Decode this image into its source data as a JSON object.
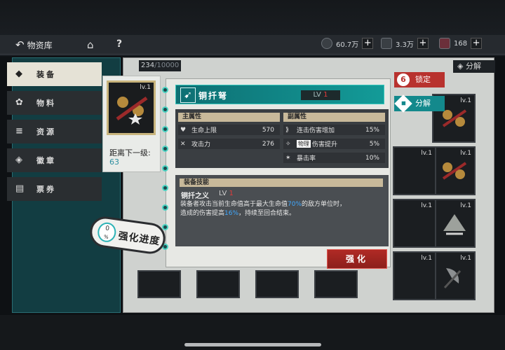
{
  "nav": {
    "back_label": "物资库",
    "resources": [
      {
        "icon": "coin-icon",
        "value": "60.7万"
      },
      {
        "icon": "material-icon",
        "value": "3.3万"
      },
      {
        "icon": "card-icon",
        "value": "168"
      }
    ]
  },
  "sidebar": {
    "tabs": [
      {
        "label": "装备",
        "icon": "equipment-icon",
        "active": true
      },
      {
        "label": "物料",
        "icon": "material-icon",
        "active": false
      },
      {
        "label": "资源",
        "icon": "resource-icon",
        "active": false
      },
      {
        "label": "徽章",
        "icon": "badge-icon",
        "active": false
      },
      {
        "label": "票券",
        "icon": "ticket-icon",
        "active": false
      }
    ]
  },
  "inventory": {
    "capacity_current": "234",
    "capacity_max": "/10000",
    "decompose_label": "分解",
    "item_level": "lv.1"
  },
  "selected": {
    "level": "lv.1",
    "next_level_label": "距离下一级:",
    "next_level_value": "63",
    "enhance_progress_pct": "0",
    "enhance_progress_unit": "%",
    "enhance_progress_label": "强化进度"
  },
  "detail": {
    "name": "铜扦弩",
    "level_prefix": "LV",
    "level_value": "1",
    "main_attr_title": "主属性",
    "sub_attr_title": "副属性",
    "main_attrs": [
      {
        "icon": "heart-icon",
        "label": "生命上限",
        "value": "570"
      },
      {
        "icon": "swords-icon",
        "label": "攻击力",
        "value": "276"
      }
    ],
    "sub_attrs": [
      {
        "icon": "damage-icon",
        "label": "连击伤害增加",
        "value": "15%"
      },
      {
        "icon": "physical-icon",
        "tag": "物理",
        "label": "伤害提升",
        "value": "5%"
      },
      {
        "icon": "crit-icon",
        "label": "暴击率",
        "value": "10%"
      }
    ],
    "skill_section_title": "装备技能",
    "skill_name": "铜扦之义",
    "skill_level_prefix": "LV",
    "skill_level_value": "1",
    "skill_desc_1": "装备者攻击当前生命值高于最大生命值",
    "skill_desc_hl1": "70%",
    "skill_desc_2": "的敌方单位时，",
    "skill_desc_3": "造成的伤害提高",
    "skill_desc_hl2": "16%",
    "skill_desc_4": "，持续至回合结束。",
    "enhance_button": "强化"
  },
  "actions": {
    "lock_label": "锁定",
    "decompose_label": "分解"
  },
  "colors": {
    "accent_teal": "#13898c",
    "accent_red": "#b8322e",
    "highlight_blue": "#3fa8ff"
  }
}
